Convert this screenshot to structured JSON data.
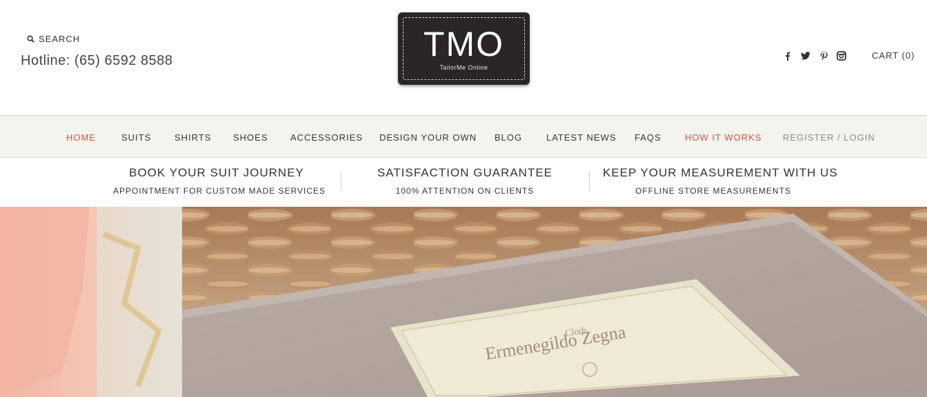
{
  "header": {
    "search_label": "SEARCH",
    "hotline": "Hotline: (65) 6592 8588",
    "logo_text": "TMO",
    "logo_sub": "TailorMe Online",
    "social": [
      "facebook-icon",
      "twitter-icon",
      "pinterest-icon",
      "instagram-icon"
    ],
    "cart_label": "CART (0)"
  },
  "nav": {
    "items": [
      {
        "label": "HOME"
      },
      {
        "label": "SUITS"
      },
      {
        "label": "SHIRTS"
      },
      {
        "label": "SHOES"
      },
      {
        "label": "ACCESSORIES"
      },
      {
        "label": "DESIGN YOUR OWN"
      },
      {
        "label": "BLOG"
      },
      {
        "label": "LATEST NEWS"
      },
      {
        "label": "FAQS"
      },
      {
        "label": "HOW IT WORKS"
      },
      {
        "label": "REGISTER / LOGIN"
      }
    ]
  },
  "promo": [
    {
      "title": "BOOK YOUR SUIT JOURNEY",
      "sub": "APPOINTMENT FOR CUSTOM MADE SERVICES"
    },
    {
      "title": "SATISFACTION GUARANTEE",
      "sub": "100% ATTENTION ON CLIENTS"
    },
    {
      "title": "KEEP YOUR MEASUREMENT WITH US",
      "sub": "OFFLINE STORE MEASUREMENTS"
    }
  ],
  "hero": {
    "label_line1": "Cloth",
    "label_line2": "Ermenegildo Zegna"
  },
  "colors": {
    "accent_red": "#d4513f",
    "nav_bg": "#f4f4ef",
    "logo_bg": "#2b2625"
  }
}
